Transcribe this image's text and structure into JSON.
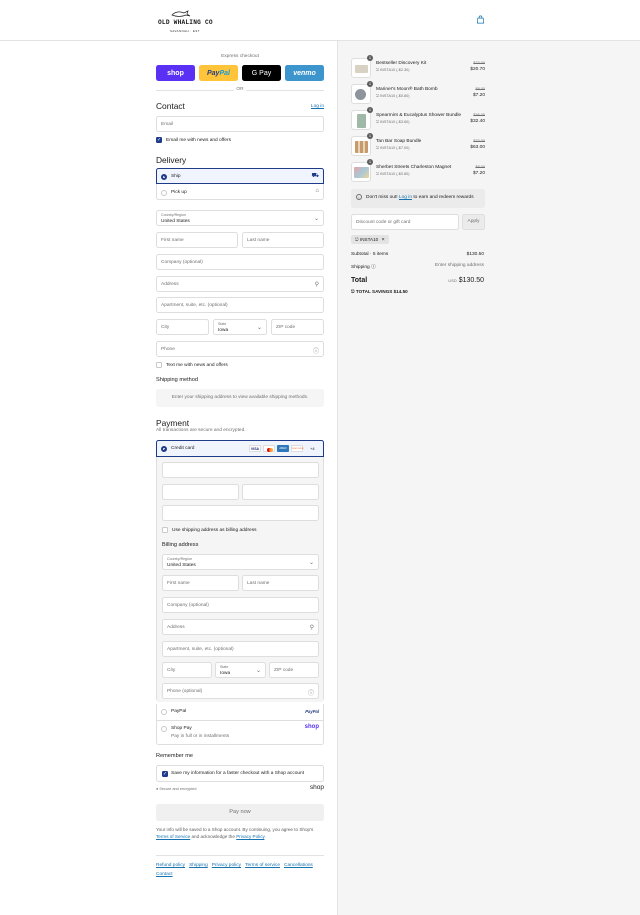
{
  "header": {
    "logo_name": "OLD WHALING CO",
    "logo_tag": "SAVANNAH · EST"
  },
  "express": {
    "label": "Express checkout",
    "shop": "shop",
    "paypal_a": "Pay",
    "paypal_b": "Pal",
    "gpay": "G Pay",
    "venmo": "venmo",
    "or": "OR"
  },
  "contact": {
    "title": "Contact",
    "login": "Log in",
    "email_placeholder": "Email",
    "news_label": "Email me with news and offers"
  },
  "delivery": {
    "title": "Delivery",
    "ship": "Ship",
    "pickup": "Pick up",
    "country_label": "Country/Region",
    "country": "United States",
    "first": "First name",
    "last": "Last name",
    "company": "Company (optional)",
    "address": "Address",
    "apartment": "Apartment, suite, etc. (optional)",
    "city": "City",
    "state_label": "State",
    "state": "Iowa",
    "zip": "ZIP code",
    "phone": "Phone",
    "text_label": "Text me with news and offers"
  },
  "shipping": {
    "title": "Shipping method",
    "message": "Enter your shipping address to view available shipping methods."
  },
  "payment": {
    "title": "Payment",
    "subtitle": "All transactions are secure and encrypted.",
    "credit": "Credit card",
    "more": "+4",
    "brands": [
      "VISA",
      "MC",
      "AMEX",
      "DISCOVER"
    ],
    "billing_same": "Use shipping address as billing address",
    "billing_title": "Billing address",
    "paypal": "PayPal",
    "paypal_logo": "PayPal",
    "shoppay": "Shop Pay",
    "shoppay_sub": "Pay in full or in installments",
    "shoppay_logo": "shop"
  },
  "remember": {
    "title": "Remember me",
    "save_label": "Save my information for a faster checkout with a Shop account",
    "secure": "Secure and encrypted",
    "shop_logo": "shop"
  },
  "pay_now": "Pay now",
  "legal": {
    "text1": "Your info will be saved to a Shop account. By continuing, you agree to Shop's",
    "terms": "Terms of Service",
    "text2": "and acknowledge the",
    "privacy": "Privacy Policy",
    "end": "."
  },
  "footer": [
    "Refund policy",
    "Shipping",
    "Privacy policy",
    "Terms of service",
    "Cancellations",
    "Contact"
  ],
  "cart": {
    "items": [
      {
        "name": "Bestseller Discovery Kit",
        "qty": "1",
        "code": "INSTA10 (-$2.30)",
        "old": "$23.00",
        "new": "$20.70"
      },
      {
        "name": "Mariner's Moon® Bath Bomb",
        "qty": "1",
        "code": "INSTA10 (-$0.80)",
        "old": "$8.00",
        "new": "$7.20"
      },
      {
        "name": "Spearmint & Eucalyptus Shower Bundle",
        "qty": "1",
        "code": "INSTA10 (-$3.60)",
        "old": "$36.00",
        "new": "$32.40"
      },
      {
        "name": "Tan Bar Soap Bundle",
        "qty": "1",
        "code": "INSTA10 (-$7.00)",
        "old": "$70.00",
        "new": "$63.00"
      },
      {
        "name": "Sherbet Streets Charleston Magnet",
        "qty": "1",
        "code": "INSTA10 (-$0.80)",
        "old": "$8.00",
        "new": "$7.20"
      }
    ],
    "rewards_pre": "Don't miss out!",
    "rewards_link": "Log in",
    "rewards_post": "to earn and redeem rewards",
    "discount_placeholder": "Discount code or gift card",
    "apply": "Apply",
    "tag": "INSTA10",
    "subtotal_label": "Subtotal · 5 items",
    "subtotal": "$130.50",
    "shipping_label": "Shipping",
    "shipping_value": "Enter shipping address",
    "total_label": "Total",
    "currency": "USD",
    "total": "$130.50",
    "savings_label": "TOTAL SAVINGS",
    "savings": "$14.50"
  }
}
